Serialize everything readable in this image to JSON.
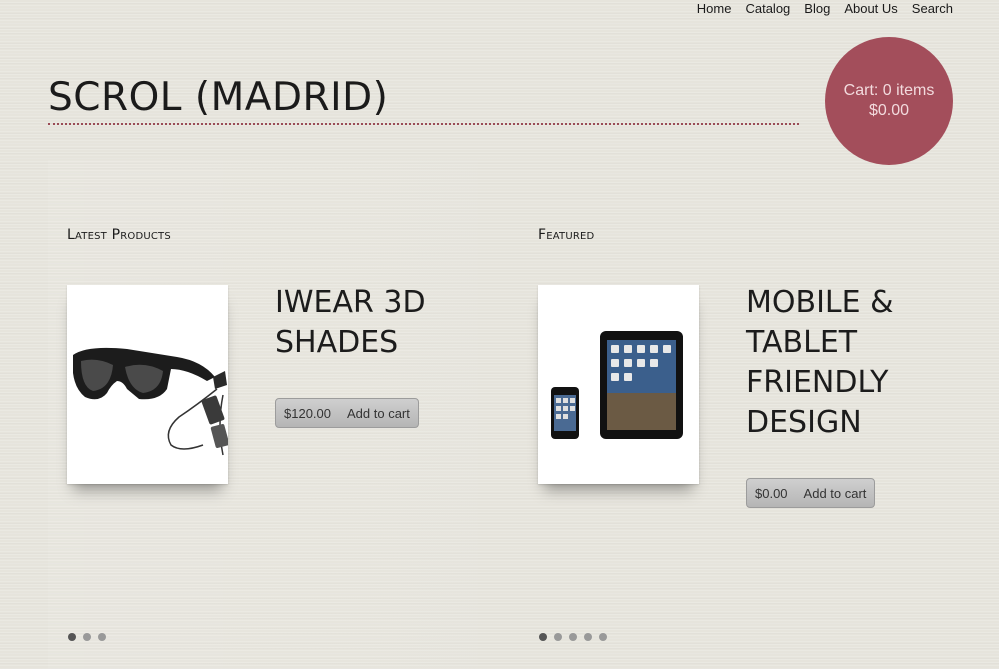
{
  "nav": {
    "items": [
      "Home",
      "Catalog",
      "Blog",
      "About Us",
      "Search"
    ]
  },
  "site": {
    "title": "SCROL (MADRID)"
  },
  "cart": {
    "label": "Cart: 0 items",
    "total": "$0.00"
  },
  "latest": {
    "heading": "Latest Products",
    "product": {
      "name": "IWEAR 3D SHADES",
      "price": "$120.00",
      "add_label": "Add to cart",
      "image_icon": "video-glasses-image"
    },
    "carousel": {
      "count": 3,
      "active": 1
    }
  },
  "featured": {
    "heading": "Featured",
    "product": {
      "name": "MOBILE & TABLET FRIENDLY DESIGN",
      "price": "$0.00",
      "add_label": "Add to cart",
      "image_icon": "tablet-and-phone-image"
    },
    "carousel": {
      "count": 5,
      "active": 1
    }
  },
  "colors": {
    "accent": "#a34e5b",
    "rule": "#9a4b55",
    "background": "#e6e4dc"
  }
}
